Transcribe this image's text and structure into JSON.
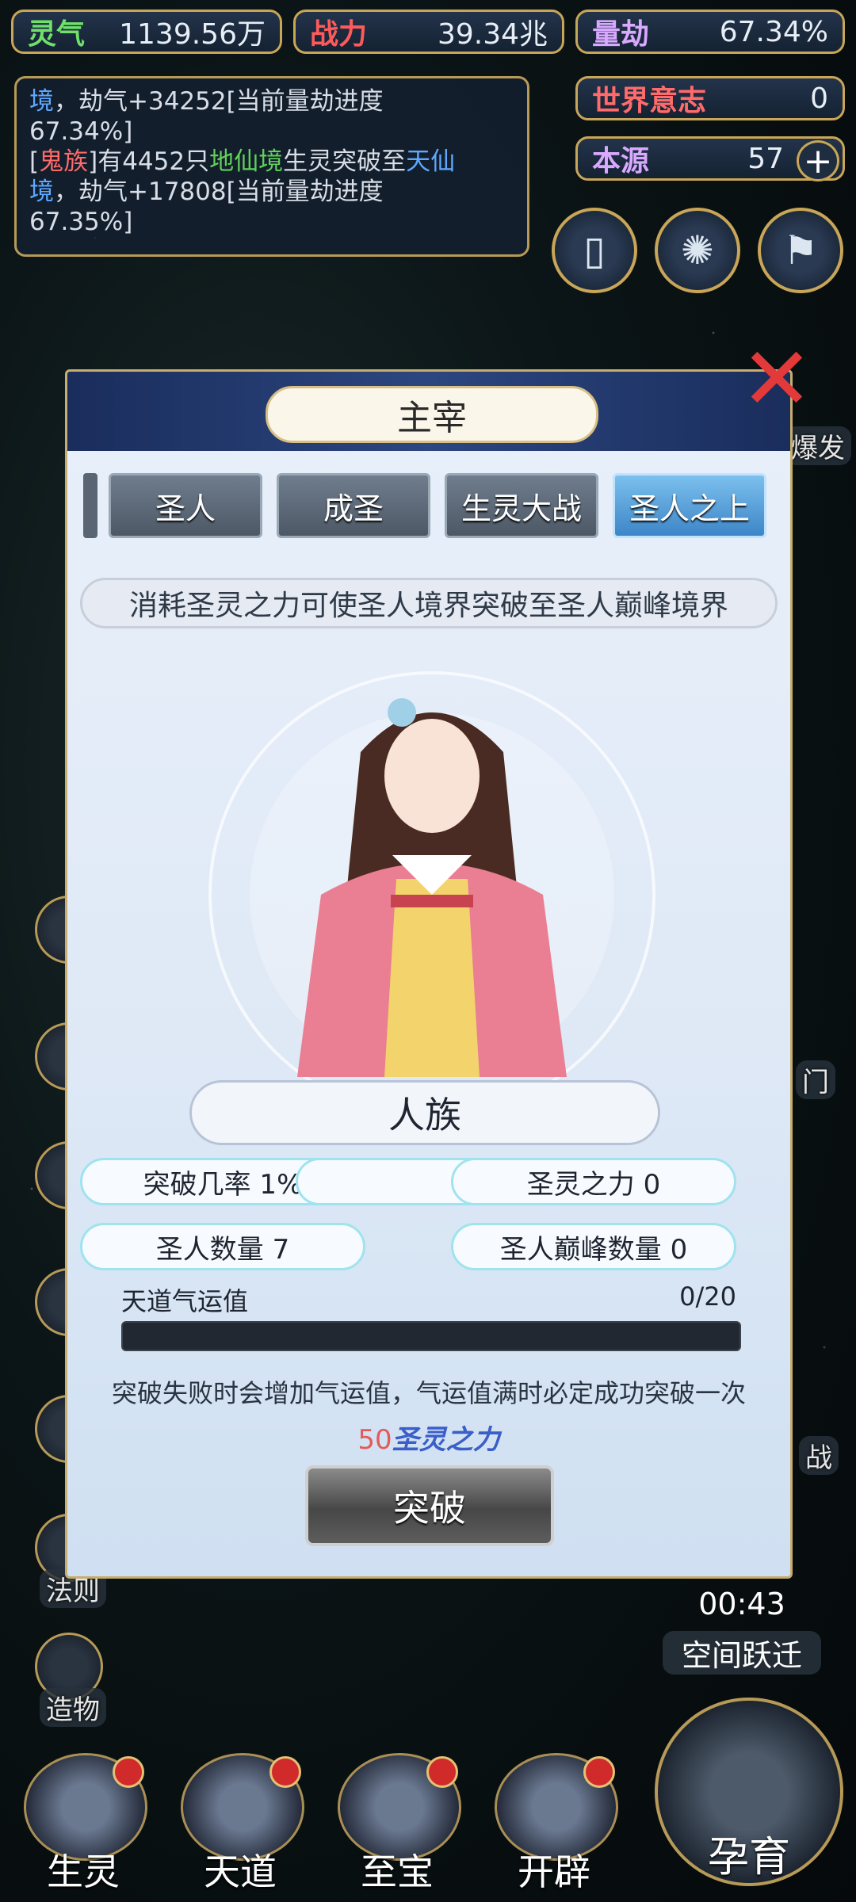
{
  "stats": {
    "lingqi": {
      "label": "灵气",
      "value": "1139.56万"
    },
    "zhanli": {
      "label": "战力",
      "value": "39.34兆"
    },
    "liangjie": {
      "label": "量劫",
      "value": "67.34%"
    },
    "world_will": {
      "label": "世界意志",
      "value": "0"
    },
    "benyuan": {
      "label": "本源",
      "value": "57"
    }
  },
  "log": {
    "line1_a": "境",
    "line1_b": "，劫气+34252[当前量劫进度",
    "line2": "67.34%]",
    "line3_a": "[",
    "line3_race": "鬼族",
    "line3_b": "]有4452只",
    "line3_realm": "地仙境",
    "line3_c": "生灵突破至",
    "line3_target": "天仙",
    "line4_a": "境",
    "line4_b": "，劫气+17808[当前量劫进度",
    "line5": "67.35%]"
  },
  "modal": {
    "title": "主宰",
    "tabs": [
      "圣人",
      "成圣",
      "生灵大战",
      "圣人之上"
    ],
    "description": "消耗圣灵之力可使圣人境界突破至圣人巅峰境界",
    "race": "人族",
    "pills": {
      "chance": "突破几率 1%",
      "power": "圣灵之力 0",
      "sage_count": "圣人数量 7",
      "peak_count": "圣人巅峰数量 0"
    },
    "luck": {
      "label": "天道气运值",
      "value": "0/20",
      "fraction": 0
    },
    "tip": "突破失败时会增加气运值，气运值满时必定成功突破一次",
    "cost": {
      "number": "50",
      "unit": "圣灵之力"
    },
    "breakthrough_button": "突破"
  },
  "side_labels": {
    "law": "法则",
    "creation": "造物",
    "burst": "爆发",
    "gate": "门",
    "war": "战"
  },
  "timer": {
    "time": "00:43",
    "label": "空间跃迁"
  },
  "bottom_nav": [
    "生灵",
    "天道",
    "至宝",
    "开辟"
  ],
  "breed": "孕育",
  "colors": {
    "accent_gold": "#c9a657",
    "tab_active": "#3d86c7",
    "close_red": "#e23a3a"
  }
}
